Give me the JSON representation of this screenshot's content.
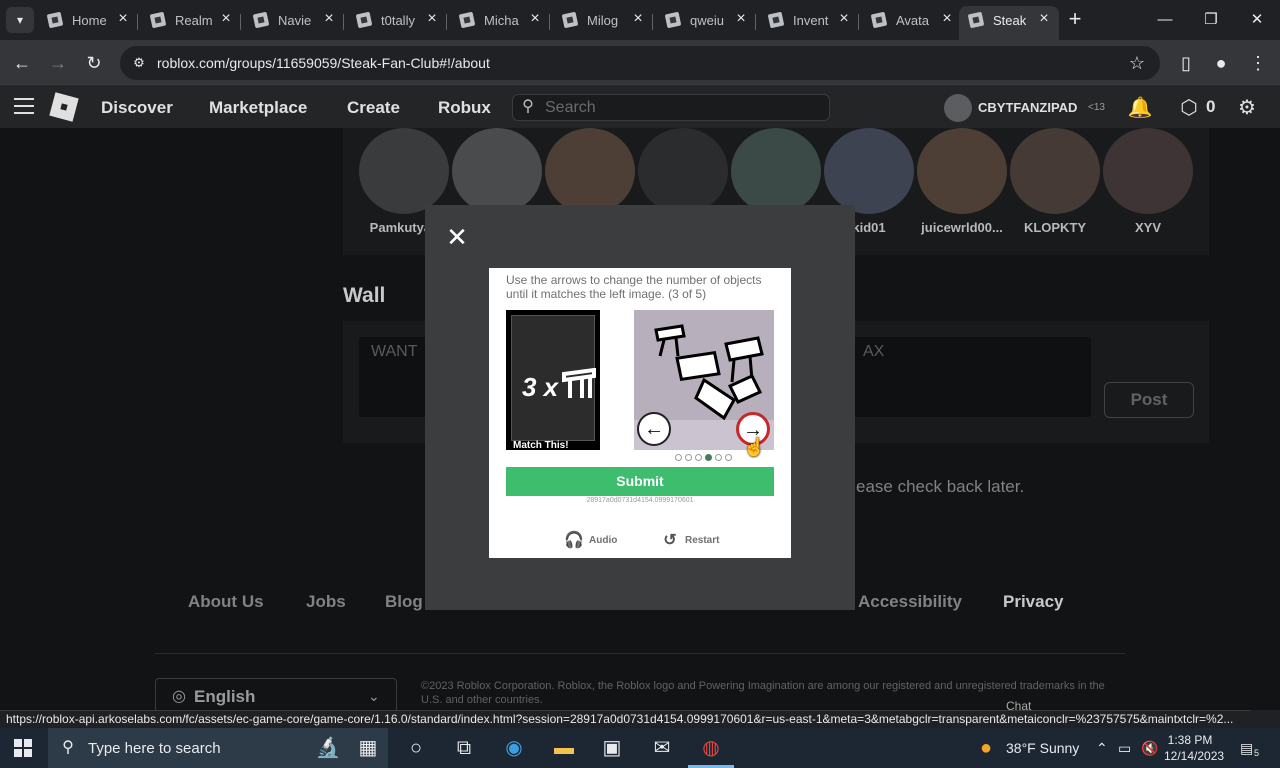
{
  "browser": {
    "tabs": [
      {
        "label": "Home",
        "active": false
      },
      {
        "label": "Realm",
        "active": false
      },
      {
        "label": "Navie",
        "active": false
      },
      {
        "label": "t0tally",
        "active": false
      },
      {
        "label": "Micha",
        "active": false
      },
      {
        "label": "Milog",
        "active": false
      },
      {
        "label": "qweiu",
        "active": false
      },
      {
        "label": "Invent",
        "active": false
      },
      {
        "label": "Avata",
        "active": false
      },
      {
        "label": "Steak",
        "active": true
      }
    ],
    "url": "roblox.com/groups/11659059/Steak-Fan-Club#!/about",
    "status_url": "https://roblox-api.arkoselabs.com/fc/assets/ec-game-core/game-core/1.16.0/standard/index.html?session=28917a0d0731d4154.0999170601&r=us-east-1&meta=3&metabgclr=transparent&metaiconclr=%23757575&maintxtclr=%2..."
  },
  "roblox_header": {
    "nav": [
      "Discover",
      "Marketplace",
      "Create",
      "Robux"
    ],
    "search_placeholder": "Search",
    "username": "CBYTFANZIPAD",
    "age_label": "<13",
    "robux": "0"
  },
  "members": [
    {
      "name": "Pamkutya_"
    },
    {
      "name": ""
    },
    {
      "name": ""
    },
    {
      "name": ""
    },
    {
      "name": ""
    },
    {
      "name": "kid01"
    },
    {
      "name": "juicewrld00..."
    },
    {
      "name": "KLOPKTY"
    },
    {
      "name": "XYV"
    }
  ],
  "wall": {
    "title": "Wall",
    "input_left": "WANT",
    "input_right": "AX",
    "post_label": "Post",
    "empty_message": "ease check back later."
  },
  "footer": {
    "links": [
      "About Us",
      "Jobs",
      "Blog",
      "Accessibility",
      "Privacy"
    ],
    "language": "English",
    "copyright": "©2023 Roblox Corporation. Roblox, the Roblox logo and Powering Imagination are among our registered and unregistered trademarks in the U.S. and other countries.",
    "chat": "Chat"
  },
  "captcha": {
    "instruction": "Use the arrows to change the number of objects until it matches the left image. (3 of 5)",
    "match_multiplier": "3 x",
    "match_label": "Match This!",
    "current_dot": 3,
    "dot_count": 6,
    "submit_label": "Submit",
    "session_id": "28917a0d0731d4154.0999170601",
    "audio_label": "Audio",
    "restart_label": "Restart",
    "left_arrow_icon": "arrow-left-icon",
    "right_arrow_icon": "arrow-right-icon"
  },
  "taskbar": {
    "search_placeholder": "Type here to search",
    "weather": "38°F  Sunny",
    "time": "1:38 PM",
    "date": "12/14/2023",
    "notification_count": "5"
  },
  "colors": {
    "submit_green": "#3ebd6f",
    "active_arrow_red": "#c62828"
  }
}
